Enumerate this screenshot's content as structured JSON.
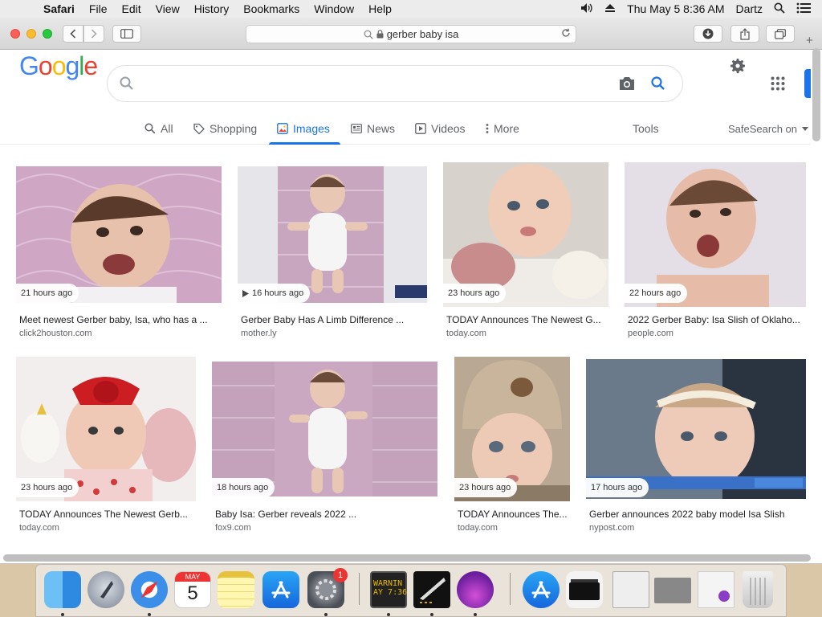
{
  "menubar": {
    "apple": "",
    "app": "Safari",
    "items": [
      "File",
      "Edit",
      "View",
      "History",
      "Bookmarks",
      "Window",
      "Help"
    ],
    "datetime": "Thu May 5  8:36 AM",
    "user": "Dartz"
  },
  "browser": {
    "address": "gerber baby isa"
  },
  "google": {
    "logo": "Google",
    "tabs": {
      "all": "All",
      "shopping": "Shopping",
      "images": "Images",
      "news": "News",
      "videos": "Videos",
      "more": "More"
    },
    "tools": "Tools",
    "safesearch": "SafeSearch on"
  },
  "results": [
    {
      "time": "21 hours ago",
      "title": "Meet newest Gerber baby, Isa, who has a ...",
      "source": "click2houston.com"
    },
    {
      "time": "16 hours ago",
      "title": "Gerber Baby Has A Limb Difference ...",
      "source": "mother.ly",
      "video": true
    },
    {
      "time": "23 hours ago",
      "title": "TODAY Announces The Newest G...",
      "source": "today.com"
    },
    {
      "time": "22 hours ago",
      "title": "2022 Gerber Baby: Isa Slish of Oklaho...",
      "source": "people.com"
    },
    {
      "time": "23 hours ago",
      "title": "TODAY Announces The Newest Gerb...",
      "source": "today.com"
    },
    {
      "time": "18 hours ago",
      "title": "Baby Isa: Gerber reveals 2022 ...",
      "source": "fox9.com"
    },
    {
      "time": "23 hours ago",
      "title": "TODAY Announces The...",
      "source": "today.com"
    },
    {
      "time": "17 hours ago",
      "title": "Gerber announces 2022 baby model Isa Slish",
      "source": "nypost.com"
    }
  ],
  "dock": {
    "calendar_month": "MAY",
    "calendar_day": "5",
    "settings_badge": "1",
    "terminal_text": "WARNIN\nAY 7:36"
  },
  "colors": {
    "google_blue": "#4285F4",
    "google_red": "#EA4335",
    "google_yellow": "#FBBC05",
    "google_green": "#34A853",
    "active_tab": "#1a73e8"
  }
}
